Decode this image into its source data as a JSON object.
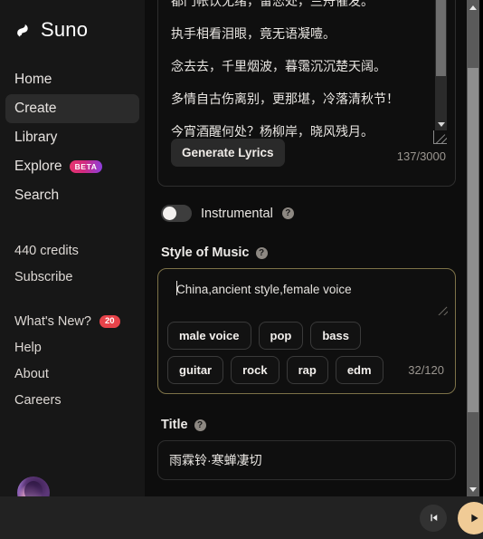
{
  "brand": {
    "name": "Suno",
    "logo_icon": "suno-logo-icon"
  },
  "sidebar": {
    "nav": [
      {
        "label": "Home",
        "active": false
      },
      {
        "label": "Create",
        "active": true
      },
      {
        "label": "Library",
        "active": false
      },
      {
        "label": "Explore",
        "active": false,
        "badge": "BETA"
      },
      {
        "label": "Search",
        "active": false
      }
    ],
    "credits": "440 credits",
    "subscribe": "Subscribe",
    "whats_new": {
      "label": "What's New?",
      "badge": "20"
    },
    "help": "Help",
    "about": "About",
    "careers": "Careers",
    "avatar_name": "user-avatar"
  },
  "lyrics": {
    "lines": [
      "都门帐饮无绪，留恋处，兰舟催发。",
      "执手相看泪眼，竟无语凝噎。",
      "念去去，千里烟波，暮霭沉沉楚天阔。",
      "多情自古伤离别，更那堪，冷落清秋节！",
      "今宵酒醒何处？杨柳岸，晓风残月。"
    ],
    "generate_button": "Generate Lyrics",
    "char_count": "137/3000"
  },
  "instrumental": {
    "label": "Instrumental",
    "enabled": false,
    "help": "?"
  },
  "style_of_music": {
    "label": "Style of Music",
    "help": "?",
    "value": "China,ancient style,female voice",
    "char_count": "32/120",
    "border_color": "#7d7248",
    "suggestions": [
      [
        "male voice",
        "pop",
        "bass"
      ],
      [
        "guitar",
        "rock",
        "rap",
        "edm"
      ]
    ]
  },
  "title": {
    "label": "Title",
    "help": "?",
    "value": "雨霖铃·寒蝉凄切"
  },
  "player": {
    "prev_icon": "skip-previous-icon",
    "play_icon": "play-icon",
    "play_color": "#f0cb96"
  },
  "scrollbars": {
    "page_scrollbar": "page-scrollbar",
    "lyrics_scrollbar": "lyrics-scrollbar"
  }
}
